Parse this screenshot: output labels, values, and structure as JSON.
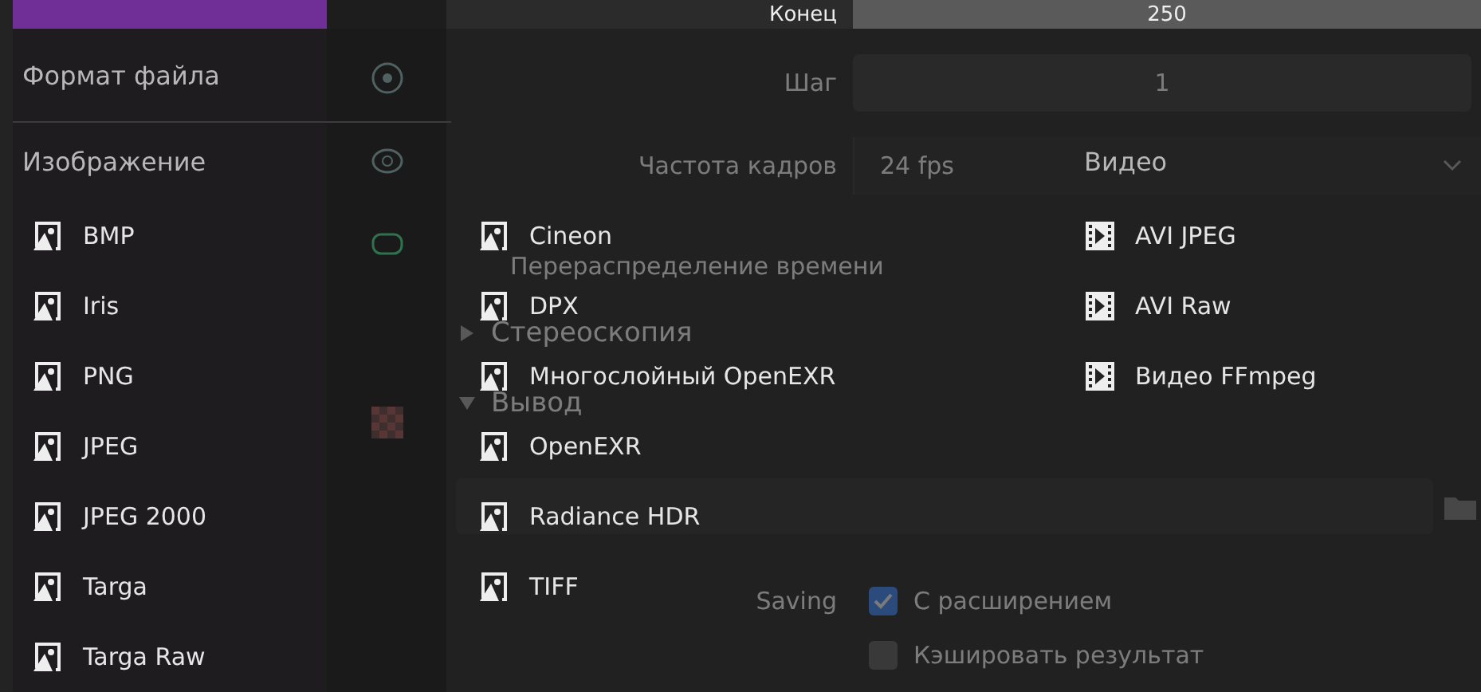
{
  "properties": {
    "frame_end": {
      "label": "Конец",
      "value": "250"
    },
    "frame_step": {
      "label": "Шаг",
      "value": "1"
    },
    "frame_rate": {
      "label": "Частота кадров",
      "value": "24 fps"
    },
    "sections": [
      {
        "label": "Перераспределение времени",
        "kind": "subpanel"
      },
      {
        "label": "Стереоскопия",
        "kind": "panel",
        "expanded": false
      },
      {
        "label": "Вывод",
        "kind": "panel",
        "expanded": true
      }
    ],
    "saving_label": "Saving",
    "checkboxes": [
      {
        "label": "С расширением",
        "checked": true
      },
      {
        "label": "Кэшировать результат",
        "checked": false
      }
    ]
  },
  "menu": {
    "title": "Формат файла",
    "columns": [
      {
        "heading": "Изображение",
        "items": [
          {
            "label": "BMP",
            "kind": "image"
          },
          {
            "label": "Iris",
            "kind": "image"
          },
          {
            "label": "PNG",
            "kind": "image"
          },
          {
            "label": "JPEG",
            "kind": "image"
          },
          {
            "label": "JPEG 2000",
            "kind": "image"
          },
          {
            "label": "Targa",
            "kind": "image"
          },
          {
            "label": "Targa Raw",
            "kind": "image"
          }
        ]
      },
      {
        "items": [
          {
            "label": "Cineon",
            "kind": "image"
          },
          {
            "label": "DPX",
            "kind": "image"
          },
          {
            "label": "Многослойный OpenEXR",
            "kind": "image"
          },
          {
            "label": "OpenEXR",
            "kind": "image"
          },
          {
            "label": "Radiance HDR",
            "kind": "image"
          },
          {
            "label": "TIFF",
            "kind": "image"
          }
        ]
      },
      {
        "heading": "Видео",
        "items": [
          {
            "label": "AVI JPEG",
            "kind": "movie"
          },
          {
            "label": "AVI Raw",
            "kind": "movie"
          },
          {
            "label": "Видео FFmpeg",
            "kind": "movie"
          }
        ]
      }
    ]
  }
}
